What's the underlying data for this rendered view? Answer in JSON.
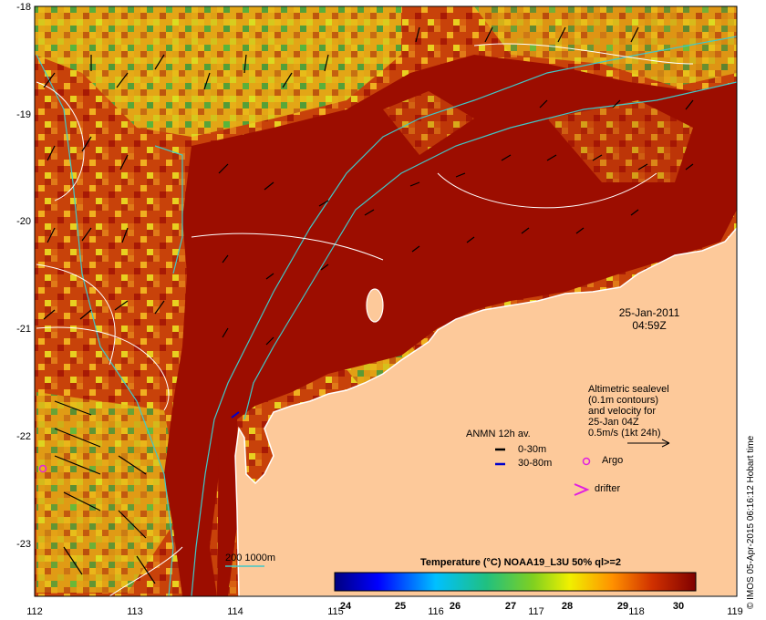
{
  "axes": {
    "x_ticks": [
      "112",
      "113",
      "114",
      "115",
      "116",
      "117",
      "118",
      "119"
    ],
    "y_ticks": [
      "-18",
      "-19",
      "-20",
      "-21",
      "-22",
      "-23"
    ]
  },
  "timestamp": {
    "date": "25-Jan-2011",
    "time": "04:59Z"
  },
  "altimetry_note": [
    "Altimetric sealevel",
    "(0.1m contours)",
    "and velocity for",
    "25-Jan 04Z",
    "0.5m/s (1kt 24h)"
  ],
  "legend": {
    "anmn_title": "ANMN 12h av.",
    "anmn_items": [
      {
        "label": "0-30m",
        "color": "#000000"
      },
      {
        "label": "30-80m",
        "color": "#0000cc"
      }
    ],
    "argo_label": "Argo",
    "drifter_label": "drifter",
    "isobath_label": "200  1000m"
  },
  "colorbar": {
    "title": "Temperature (°C) NOAA19_L3U 50% ql>=2",
    "ticks": [
      "24",
      "25",
      "26",
      "27",
      "28",
      "29",
      "30"
    ]
  },
  "credit": "© IMOS 05-Apr-2015 06:16:12 Hobart time",
  "colors": {
    "land": "#fdc99a",
    "warm": "#9c0d00",
    "isobath": "#40c8c8",
    "contour": "#ffffff",
    "argo": "#e020e0"
  }
}
